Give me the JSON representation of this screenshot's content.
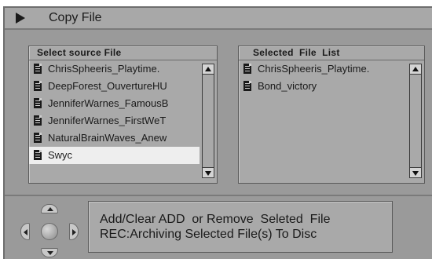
{
  "window": {
    "title": "Copy File",
    "icon": "play-icon"
  },
  "source_panel": {
    "header": "Select source File",
    "items": [
      {
        "label": "ChrisSpheeris_Playtime."
      },
      {
        "label": "DeepForest_OuvertureHU"
      },
      {
        "label": "JenniferWarnes_FamousB"
      },
      {
        "label": "JenniferWarnes_FirstWeT"
      },
      {
        "label": "NaturalBrainWaves_Anew"
      },
      {
        "label": "Swyc",
        "selected": true
      }
    ]
  },
  "selected_panel": {
    "header": "Selected  File  List",
    "items": [
      {
        "label": "ChrisSpheeris_Playtime."
      },
      {
        "label": "Bond_victory"
      }
    ]
  },
  "help": {
    "line1": "Add/Clear ADD  or Remove  Seleted  File",
    "line2": "REC:Archiving Selected File(s) To Disc"
  },
  "colors": {
    "background": "#9a9a9a",
    "panel": "#a9a9a9",
    "selected_row": "#eeeeee",
    "text": "#1a1a1a"
  }
}
